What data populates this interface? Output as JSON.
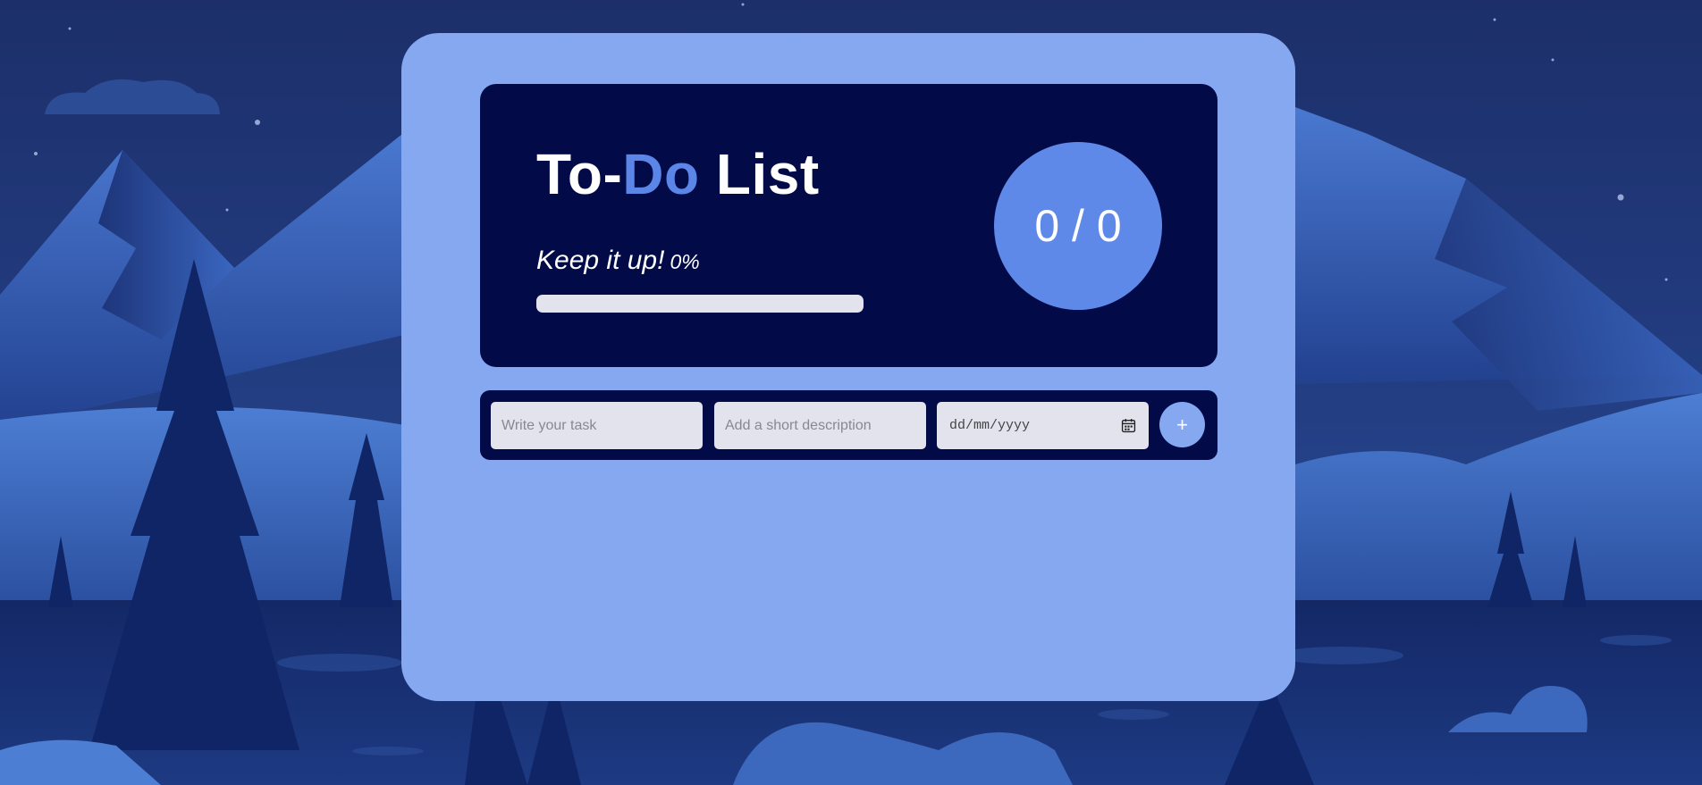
{
  "header": {
    "title_part1": "To-",
    "title_accent": "Do",
    "title_part2": " List",
    "subtitle": "Keep it up!",
    "percent": "0%",
    "progress_fraction": 0,
    "counter": "0 / 0"
  },
  "form": {
    "task_placeholder": "Write your task",
    "description_placeholder": "Add a short description",
    "date_placeholder": "dd/mm/yyyy",
    "date_icon": "calendar-icon",
    "add_label": "+"
  },
  "colors": {
    "page_background": "#1f3a7a",
    "card": "#85a8f1",
    "panel": "#020b48",
    "accent": "#5b86e8",
    "field": "#e3e3ee",
    "text_on_dark": "#ffffff"
  }
}
